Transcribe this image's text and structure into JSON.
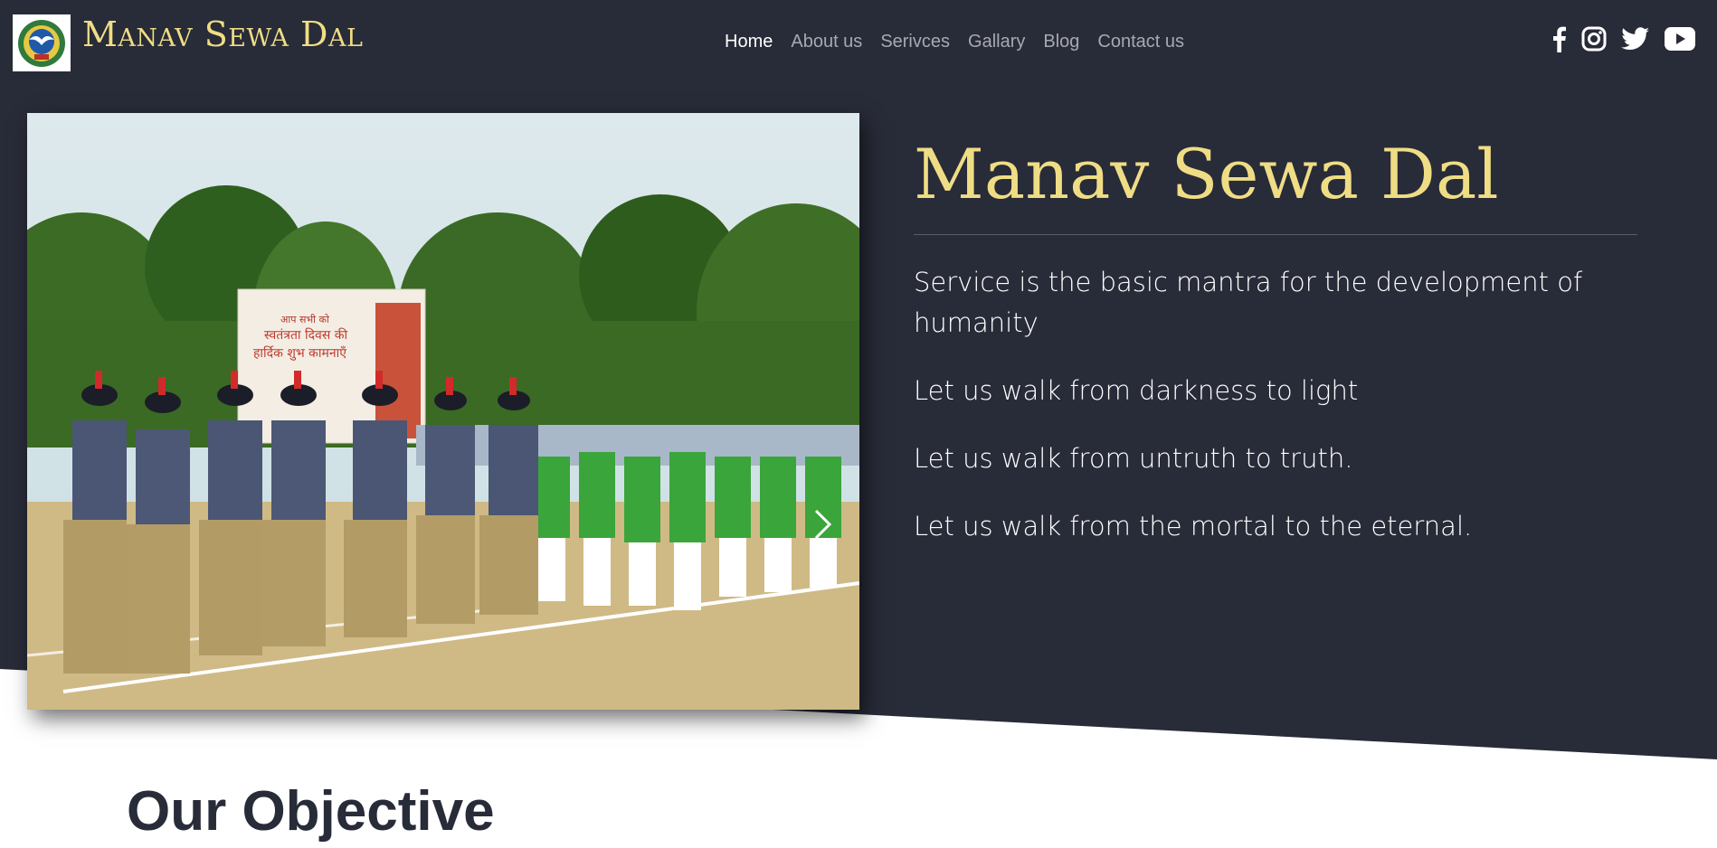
{
  "header": {
    "brand": "Manav Sewa Dal",
    "nav": [
      {
        "label": "Home",
        "active": true
      },
      {
        "label": "About us",
        "active": false
      },
      {
        "label": "Serivces",
        "active": false
      },
      {
        "label": "Gallary",
        "active": false
      },
      {
        "label": "Blog",
        "active": false
      },
      {
        "label": "Contact us",
        "active": false
      }
    ],
    "social_icons": [
      "facebook-icon",
      "instagram-icon",
      "twitter-icon",
      "youtube-icon"
    ]
  },
  "carousel": {
    "banner_text": [
      "आप सभी को",
      "स्वतंत्रता दिवस की",
      "हार्दिक शुभ कामनाएँ"
    ],
    "next_icon": "chevron-right-icon"
  },
  "hero": {
    "title": "Manav Sewa Dal",
    "quotes": [
      "Service is the basic mantra for the development of humanity",
      "Let us walk from darkness to light",
      "Let us walk from untruth to truth.",
      "Let us walk from the mortal to the eternal."
    ]
  },
  "objective": {
    "title": "Our Objective"
  },
  "colors": {
    "hero_bg": "#282b38",
    "accent_gold": "#efdd85",
    "nav_inactive": "#a7a9b1"
  }
}
